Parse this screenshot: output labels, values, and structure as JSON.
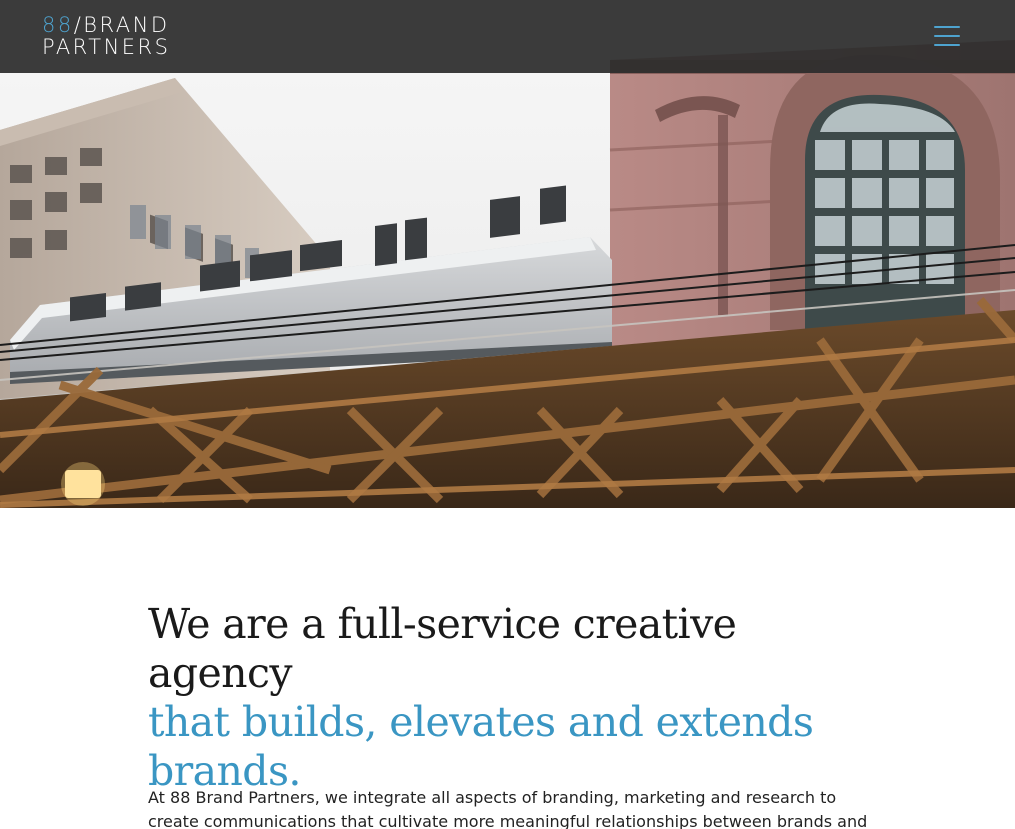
{
  "header": {
    "logo": {
      "number": "88",
      "slash_word": "/BRAND",
      "second_word": "PARTNERS"
    },
    "menu_icon": "hamburger-menu-icon",
    "accent_color": "#4ea3cf"
  },
  "hero": {
    "image": "elevated-train-chicago-photo"
  },
  "intro": {
    "headline_dark": "We are a full-service creative agency",
    "headline_accent": "that builds, elevates and extends brands.",
    "accent_color": "#3a96c3",
    "body": "At 88 Brand Partners, we integrate all aspects of branding, marketing and research to create communications that cultivate more meaningful relationships between brands and"
  }
}
